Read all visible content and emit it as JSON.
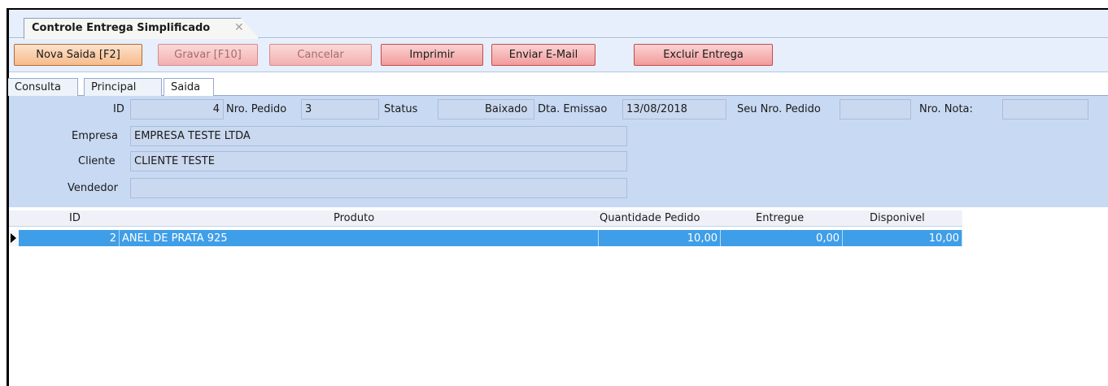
{
  "document_tab": {
    "title": "Controle Entrega Simplificado",
    "close_glyph": "✕"
  },
  "toolbar": {
    "nova_saida": "Nova Saida [F2]",
    "gravar": "Gravar [F10]",
    "cancelar": "Cancelar",
    "imprimir": "Imprimir",
    "enviar_email": "Enviar E-Mail",
    "excluir_entrega": "Excluir Entrega"
  },
  "tabs": {
    "consulta": "Consulta",
    "principal": "Principal",
    "saida": "Saida"
  },
  "form": {
    "id_label": "ID",
    "id_value": "4",
    "nro_pedido_label": "Nro. Pedido",
    "nro_pedido_value": "3",
    "status_label": "Status",
    "status_value": "Baixado",
    "dta_emissao_label": "Dta. Emissao",
    "dta_emissao_value": "13/08/2018",
    "seu_nro_pedido_label": "Seu Nro. Pedido",
    "seu_nro_pedido_value": "",
    "nro_nota_label": "Nro. Nota:",
    "nro_nota_value": "",
    "empresa_label": "Empresa",
    "empresa_value": "EMPRESA TESTE LTDA",
    "cliente_label": "Cliente",
    "cliente_value": "CLIENTE TESTE",
    "vendedor_label": "Vendedor",
    "vendedor_value": ""
  },
  "grid": {
    "columns": {
      "id": "ID",
      "produto": "Produto",
      "quantidade_pedido": "Quantidade Pedido",
      "entregue": "Entregue",
      "disponivel": "Disponivel"
    },
    "rows": [
      {
        "id": "2",
        "produto": "ANEL DE PRATA 925",
        "quantidade_pedido": "10,00",
        "entregue": "0,00",
        "disponivel": "10,00"
      }
    ]
  },
  "colors": {
    "accent_row": "#3f9ee8",
    "form_bg": "#c8d9f3",
    "button_red": "#f29b9b",
    "button_primary": "#f6bb8a"
  }
}
